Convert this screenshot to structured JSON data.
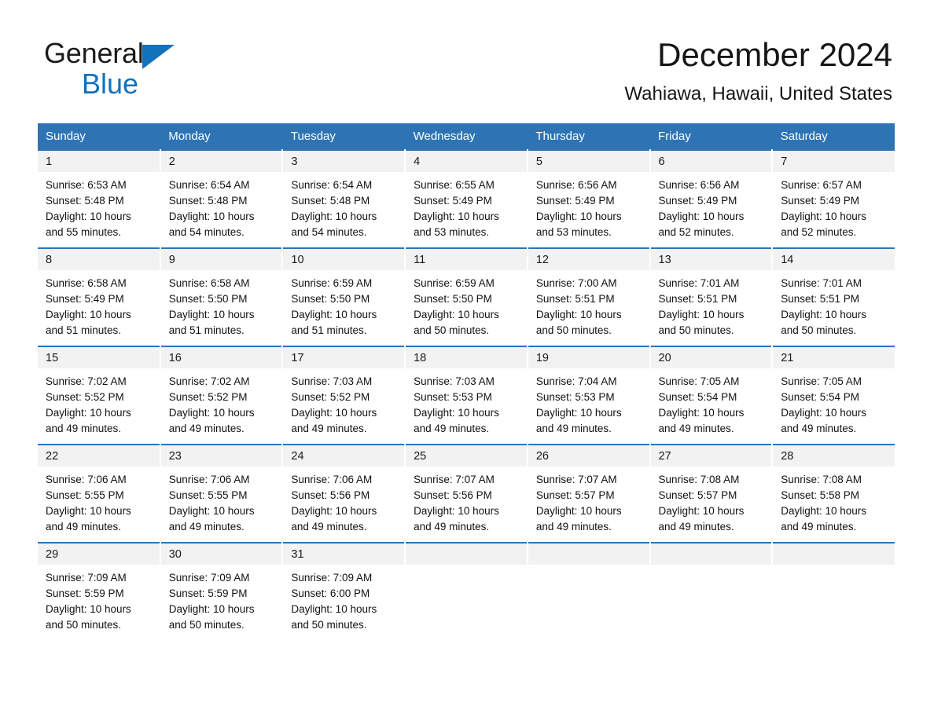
{
  "brand": {
    "name_part1": "General",
    "name_part2": "Blue",
    "accent_color": "#1272bc"
  },
  "header": {
    "title": "December 2024",
    "location": "Wahiawa, Hawaii, United States"
  },
  "theme": {
    "header_blue": "#2e74b5",
    "daynum_band": "#f2f2f2",
    "text": "#111111"
  },
  "weekday_headers": [
    "Sunday",
    "Monday",
    "Tuesday",
    "Wednesday",
    "Thursday",
    "Friday",
    "Saturday"
  ],
  "weeks": [
    [
      {
        "day": "1",
        "sunrise": "Sunrise: 6:53 AM",
        "sunset": "Sunset: 5:48 PM",
        "daylight_l1": "Daylight: 10 hours",
        "daylight_l2": "and 55 minutes."
      },
      {
        "day": "2",
        "sunrise": "Sunrise: 6:54 AM",
        "sunset": "Sunset: 5:48 PM",
        "daylight_l1": "Daylight: 10 hours",
        "daylight_l2": "and 54 minutes."
      },
      {
        "day": "3",
        "sunrise": "Sunrise: 6:54 AM",
        "sunset": "Sunset: 5:48 PM",
        "daylight_l1": "Daylight: 10 hours",
        "daylight_l2": "and 54 minutes."
      },
      {
        "day": "4",
        "sunrise": "Sunrise: 6:55 AM",
        "sunset": "Sunset: 5:49 PM",
        "daylight_l1": "Daylight: 10 hours",
        "daylight_l2": "and 53 minutes."
      },
      {
        "day": "5",
        "sunrise": "Sunrise: 6:56 AM",
        "sunset": "Sunset: 5:49 PM",
        "daylight_l1": "Daylight: 10 hours",
        "daylight_l2": "and 53 minutes."
      },
      {
        "day": "6",
        "sunrise": "Sunrise: 6:56 AM",
        "sunset": "Sunset: 5:49 PM",
        "daylight_l1": "Daylight: 10 hours",
        "daylight_l2": "and 52 minutes."
      },
      {
        "day": "7",
        "sunrise": "Sunrise: 6:57 AM",
        "sunset": "Sunset: 5:49 PM",
        "daylight_l1": "Daylight: 10 hours",
        "daylight_l2": "and 52 minutes."
      }
    ],
    [
      {
        "day": "8",
        "sunrise": "Sunrise: 6:58 AM",
        "sunset": "Sunset: 5:49 PM",
        "daylight_l1": "Daylight: 10 hours",
        "daylight_l2": "and 51 minutes."
      },
      {
        "day": "9",
        "sunrise": "Sunrise: 6:58 AM",
        "sunset": "Sunset: 5:50 PM",
        "daylight_l1": "Daylight: 10 hours",
        "daylight_l2": "and 51 minutes."
      },
      {
        "day": "10",
        "sunrise": "Sunrise: 6:59 AM",
        "sunset": "Sunset: 5:50 PM",
        "daylight_l1": "Daylight: 10 hours",
        "daylight_l2": "and 51 minutes."
      },
      {
        "day": "11",
        "sunrise": "Sunrise: 6:59 AM",
        "sunset": "Sunset: 5:50 PM",
        "daylight_l1": "Daylight: 10 hours",
        "daylight_l2": "and 50 minutes."
      },
      {
        "day": "12",
        "sunrise": "Sunrise: 7:00 AM",
        "sunset": "Sunset: 5:51 PM",
        "daylight_l1": "Daylight: 10 hours",
        "daylight_l2": "and 50 minutes."
      },
      {
        "day": "13",
        "sunrise": "Sunrise: 7:01 AM",
        "sunset": "Sunset: 5:51 PM",
        "daylight_l1": "Daylight: 10 hours",
        "daylight_l2": "and 50 minutes."
      },
      {
        "day": "14",
        "sunrise": "Sunrise: 7:01 AM",
        "sunset": "Sunset: 5:51 PM",
        "daylight_l1": "Daylight: 10 hours",
        "daylight_l2": "and 50 minutes."
      }
    ],
    [
      {
        "day": "15",
        "sunrise": "Sunrise: 7:02 AM",
        "sunset": "Sunset: 5:52 PM",
        "daylight_l1": "Daylight: 10 hours",
        "daylight_l2": "and 49 minutes."
      },
      {
        "day": "16",
        "sunrise": "Sunrise: 7:02 AM",
        "sunset": "Sunset: 5:52 PM",
        "daylight_l1": "Daylight: 10 hours",
        "daylight_l2": "and 49 minutes."
      },
      {
        "day": "17",
        "sunrise": "Sunrise: 7:03 AM",
        "sunset": "Sunset: 5:52 PM",
        "daylight_l1": "Daylight: 10 hours",
        "daylight_l2": "and 49 minutes."
      },
      {
        "day": "18",
        "sunrise": "Sunrise: 7:03 AM",
        "sunset": "Sunset: 5:53 PM",
        "daylight_l1": "Daylight: 10 hours",
        "daylight_l2": "and 49 minutes."
      },
      {
        "day": "19",
        "sunrise": "Sunrise: 7:04 AM",
        "sunset": "Sunset: 5:53 PM",
        "daylight_l1": "Daylight: 10 hours",
        "daylight_l2": "and 49 minutes."
      },
      {
        "day": "20",
        "sunrise": "Sunrise: 7:05 AM",
        "sunset": "Sunset: 5:54 PM",
        "daylight_l1": "Daylight: 10 hours",
        "daylight_l2": "and 49 minutes."
      },
      {
        "day": "21",
        "sunrise": "Sunrise: 7:05 AM",
        "sunset": "Sunset: 5:54 PM",
        "daylight_l1": "Daylight: 10 hours",
        "daylight_l2": "and 49 minutes."
      }
    ],
    [
      {
        "day": "22",
        "sunrise": "Sunrise: 7:06 AM",
        "sunset": "Sunset: 5:55 PM",
        "daylight_l1": "Daylight: 10 hours",
        "daylight_l2": "and 49 minutes."
      },
      {
        "day": "23",
        "sunrise": "Sunrise: 7:06 AM",
        "sunset": "Sunset: 5:55 PM",
        "daylight_l1": "Daylight: 10 hours",
        "daylight_l2": "and 49 minutes."
      },
      {
        "day": "24",
        "sunrise": "Sunrise: 7:06 AM",
        "sunset": "Sunset: 5:56 PM",
        "daylight_l1": "Daylight: 10 hours",
        "daylight_l2": "and 49 minutes."
      },
      {
        "day": "25",
        "sunrise": "Sunrise: 7:07 AM",
        "sunset": "Sunset: 5:56 PM",
        "daylight_l1": "Daylight: 10 hours",
        "daylight_l2": "and 49 minutes."
      },
      {
        "day": "26",
        "sunrise": "Sunrise: 7:07 AM",
        "sunset": "Sunset: 5:57 PM",
        "daylight_l1": "Daylight: 10 hours",
        "daylight_l2": "and 49 minutes."
      },
      {
        "day": "27",
        "sunrise": "Sunrise: 7:08 AM",
        "sunset": "Sunset: 5:57 PM",
        "daylight_l1": "Daylight: 10 hours",
        "daylight_l2": "and 49 minutes."
      },
      {
        "day": "28",
        "sunrise": "Sunrise: 7:08 AM",
        "sunset": "Sunset: 5:58 PM",
        "daylight_l1": "Daylight: 10 hours",
        "daylight_l2": "and 49 minutes."
      }
    ],
    [
      {
        "day": "29",
        "sunrise": "Sunrise: 7:09 AM",
        "sunset": "Sunset: 5:59 PM",
        "daylight_l1": "Daylight: 10 hours",
        "daylight_l2": "and 50 minutes."
      },
      {
        "day": "30",
        "sunrise": "Sunrise: 7:09 AM",
        "sunset": "Sunset: 5:59 PM",
        "daylight_l1": "Daylight: 10 hours",
        "daylight_l2": "and 50 minutes."
      },
      {
        "day": "31",
        "sunrise": "Sunrise: 7:09 AM",
        "sunset": "Sunset: 6:00 PM",
        "daylight_l1": "Daylight: 10 hours",
        "daylight_l2": "and 50 minutes."
      },
      {
        "day": "",
        "sunrise": "",
        "sunset": "",
        "daylight_l1": "",
        "daylight_l2": ""
      },
      {
        "day": "",
        "sunrise": "",
        "sunset": "",
        "daylight_l1": "",
        "daylight_l2": ""
      },
      {
        "day": "",
        "sunrise": "",
        "sunset": "",
        "daylight_l1": "",
        "daylight_l2": ""
      },
      {
        "day": "",
        "sunrise": "",
        "sunset": "",
        "daylight_l1": "",
        "daylight_l2": ""
      }
    ]
  ]
}
